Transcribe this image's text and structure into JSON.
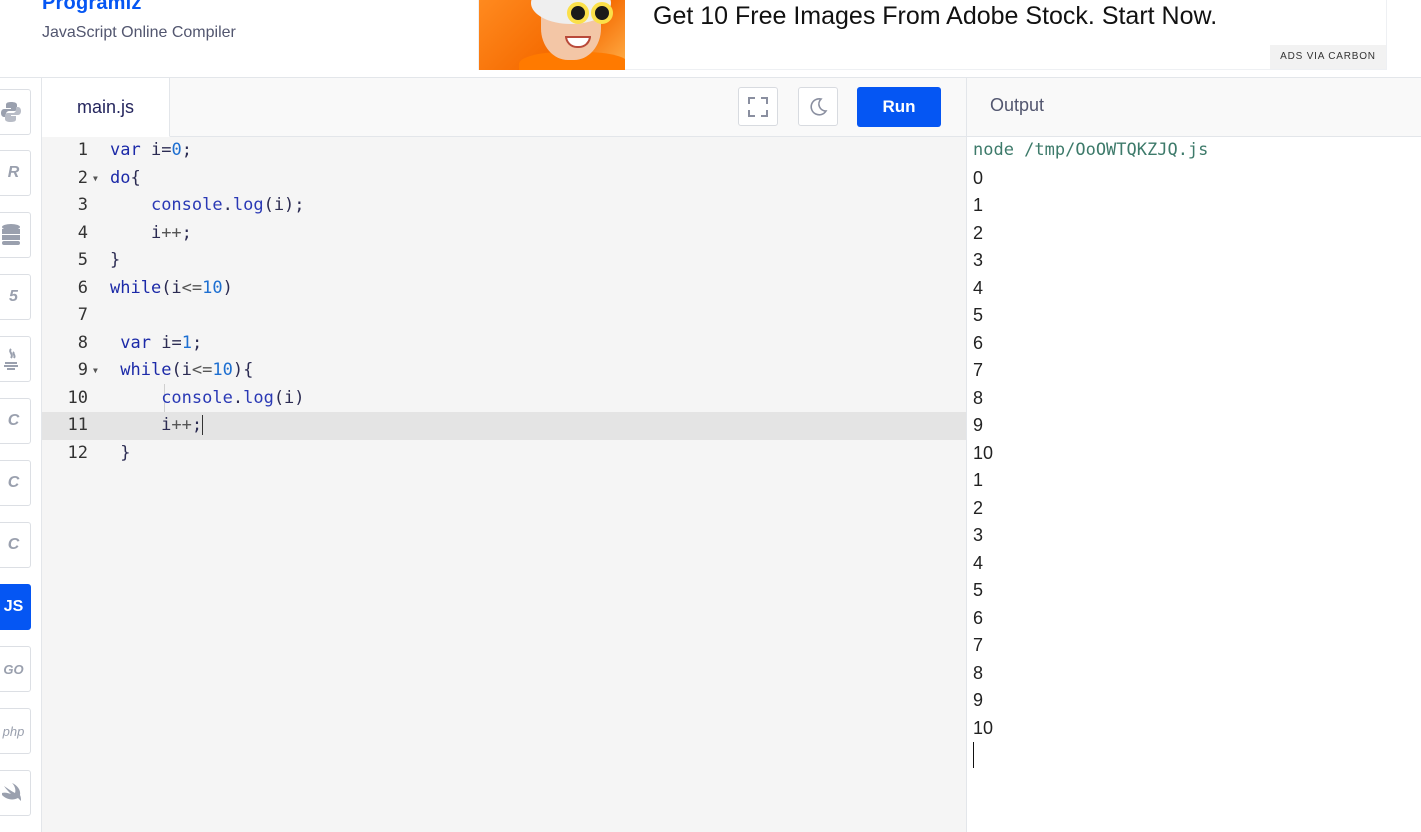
{
  "header": {
    "brand": "Programiz",
    "subtitle": "JavaScript Online Compiler"
  },
  "ad": {
    "text": "Get 10 Free Images From Adobe Stock. Start Now.",
    "via": "ADS VIA CARBON"
  },
  "languages": [
    {
      "name": "python",
      "icon": "python-icon",
      "glyph": "",
      "active": false
    },
    {
      "name": "r",
      "icon": "r-icon",
      "glyph": "R",
      "active": false
    },
    {
      "name": "sql",
      "icon": "database-icon",
      "glyph": "",
      "active": false
    },
    {
      "name": "html",
      "icon": "html5-icon",
      "glyph": "5",
      "active": false
    },
    {
      "name": "java",
      "icon": "java-icon",
      "glyph": "",
      "active": false
    },
    {
      "name": "c",
      "icon": "c-icon",
      "glyph": "C",
      "active": false
    },
    {
      "name": "cpp",
      "icon": "cpp-icon",
      "glyph": "C",
      "active": false
    },
    {
      "name": "csharp",
      "icon": "csharp-icon",
      "glyph": "C",
      "active": false
    },
    {
      "name": "javascript",
      "icon": "js-icon",
      "glyph": "JS",
      "active": true
    },
    {
      "name": "go",
      "icon": "go-icon",
      "glyph": "GO",
      "active": false
    },
    {
      "name": "php",
      "icon": "php-icon",
      "glyph": "php",
      "active": false
    },
    {
      "name": "swift",
      "icon": "swift-icon",
      "glyph": "",
      "active": false
    }
  ],
  "editor": {
    "file_tab": "main.js",
    "run_label": "Run",
    "active_line": 11,
    "lines": [
      "var i=0;",
      "do{",
      "    console.log(i);",
      "    i++;",
      "}",
      "while(i<=10)",
      "",
      " var i=1;",
      " while(i<=10){",
      "     console.log(i)",
      "     i++;",
      " }"
    ]
  },
  "output": {
    "title": "Output",
    "command": "node /tmp/OoOWTQKZJQ.js",
    "lines": [
      "0",
      "1",
      "2",
      "3",
      "4",
      "5",
      "6",
      "7",
      "8",
      "9",
      "10",
      "1",
      "2",
      "3",
      "4",
      "5",
      "6",
      "7",
      "8",
      "9",
      "10"
    ]
  }
}
